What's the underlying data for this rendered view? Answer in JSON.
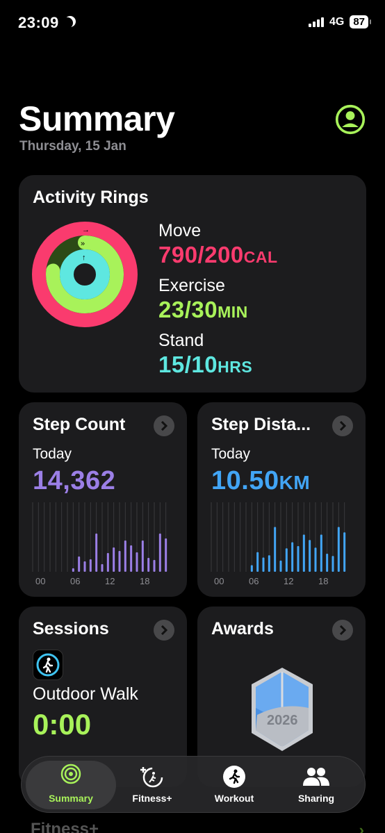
{
  "status": {
    "time": "23:09",
    "network": "4G",
    "battery": "87"
  },
  "header": {
    "title": "Summary",
    "date": "Thursday, 15 Jan"
  },
  "rings": {
    "title": "Activity Rings",
    "move": {
      "label": "Move",
      "value": "790/200",
      "unit": "CAL",
      "color": "#fa3b6e",
      "fraction": 3.95
    },
    "exercise": {
      "label": "Exercise",
      "value": "23/30",
      "unit": "MIN",
      "color": "#a8f25a",
      "fraction": 0.77
    },
    "stand": {
      "label": "Stand",
      "value": "15/10",
      "unit": "HRS",
      "color": "#5ee7e0",
      "fraction": 1.5
    }
  },
  "step_count": {
    "title": "Step Count",
    "period": "Today",
    "value": "14,362",
    "color": "#9b7fe6",
    "ticks": [
      "00",
      "06",
      "12",
      "18"
    ],
    "hourly": [
      0,
      0,
      0,
      0,
      0,
      0,
      0,
      0.05,
      0.22,
      0.15,
      0.18,
      0.55,
      0.11,
      0.27,
      0.35,
      0.3,
      0.45,
      0.38,
      0.28,
      0.45,
      0.2,
      0.17,
      0.55,
      0.48,
      0.14
    ]
  },
  "step_distance": {
    "title": "Step Dista...",
    "period": "Today",
    "value": "10.50",
    "unit": "KM",
    "color": "#42a5f5",
    "ticks": [
      "00",
      "06",
      "12",
      "18"
    ]
  },
  "sessions": {
    "title": "Sessions",
    "workout": "Outdoor Walk",
    "duration": "0:00"
  },
  "awards": {
    "title": "Awards",
    "badge_year": "2026"
  },
  "tabs": [
    {
      "label": "Summary",
      "icon": "summary-rings-icon"
    },
    {
      "label": "Fitness+",
      "icon": "fitness-plus-icon"
    },
    {
      "label": "Workout",
      "icon": "workout-runner-icon"
    },
    {
      "label": "Sharing",
      "icon": "sharing-people-icon"
    }
  ],
  "peek": {
    "label": "Fitness+"
  }
}
